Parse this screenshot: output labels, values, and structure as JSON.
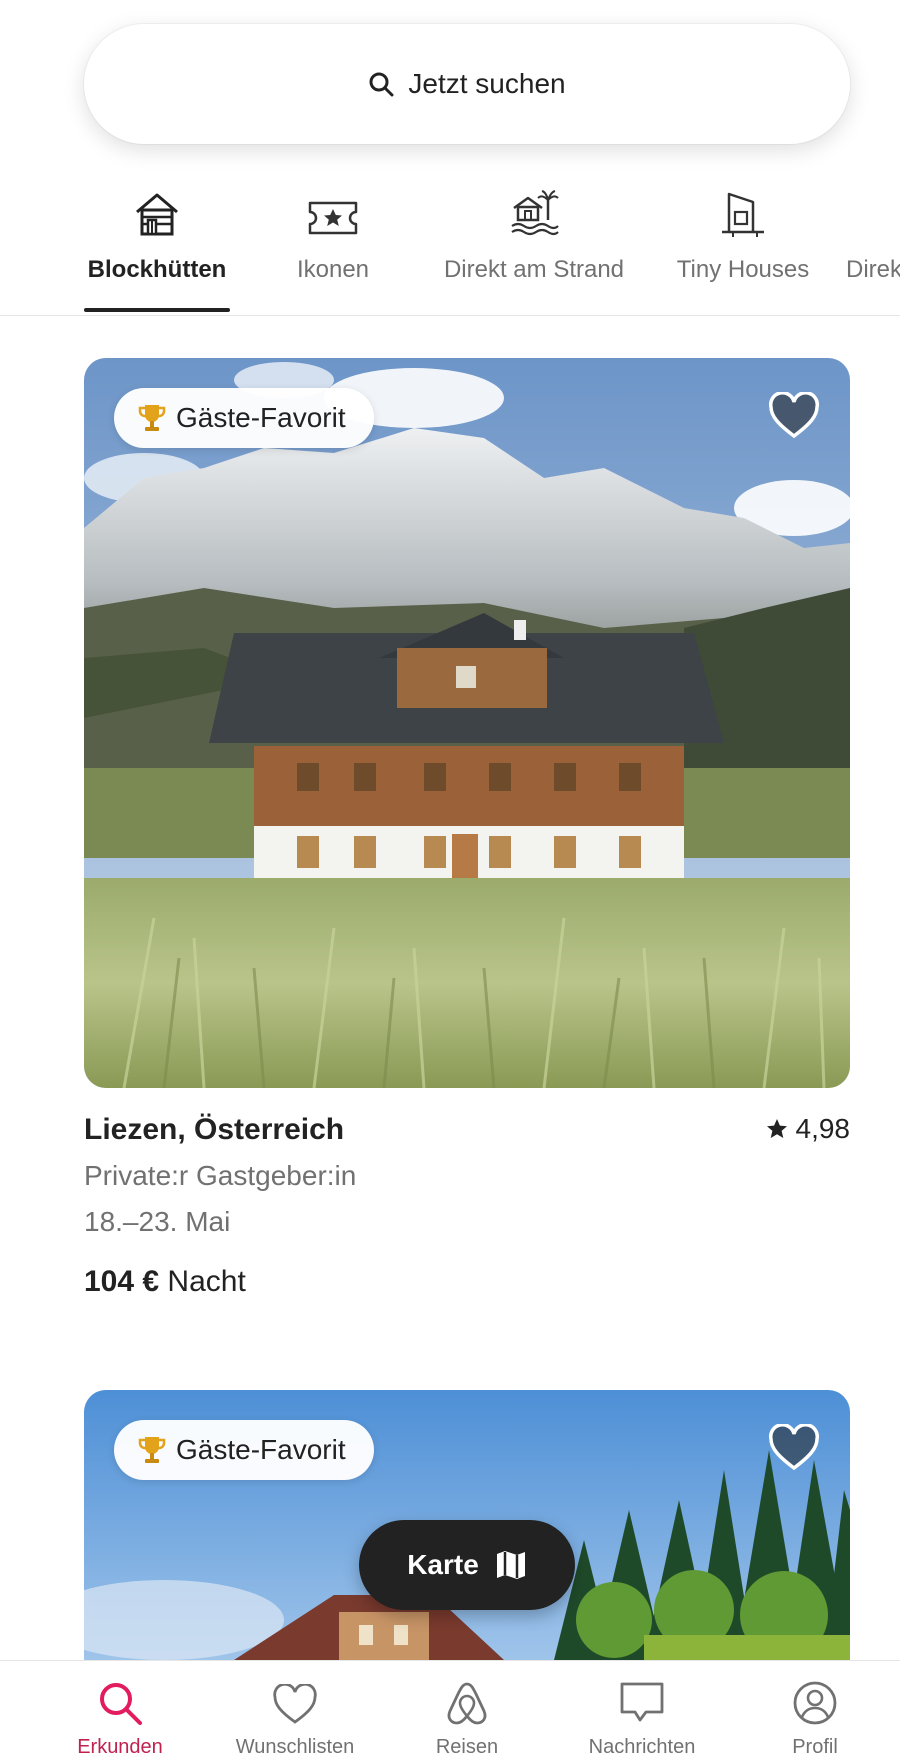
{
  "search": {
    "label": "Jetzt suchen",
    "icon": "search-icon"
  },
  "categories": [
    {
      "label": "Blockhütten",
      "icon": "cabin-icon",
      "active": true
    },
    {
      "label": "Ikonen",
      "icon": "ticket-star-icon",
      "active": false
    },
    {
      "label": "Direkt am Strand",
      "icon": "beach-house-icon",
      "active": false
    },
    {
      "label": "Tiny Houses",
      "icon": "tiny-house-icon",
      "active": false
    },
    {
      "label": "Direk",
      "icon": "",
      "active": false
    }
  ],
  "listings": [
    {
      "badge": "Gäste-Favorit",
      "location": "Liezen, Österreich",
      "rating": "4,98",
      "host": "Private:r Gastgeber:in",
      "dates": "18.–23. Mai",
      "price": "104 €",
      "price_unit": "Nacht"
    },
    {
      "badge": "Gäste-Favorit"
    }
  ],
  "map_button": {
    "label": "Karte",
    "icon": "map-icon"
  },
  "nav": [
    {
      "label": "Erkunden",
      "icon": "search-icon",
      "active": true
    },
    {
      "label": "Wunschlisten",
      "icon": "heart-icon",
      "active": false
    },
    {
      "label": "Reisen",
      "icon": "airbnb-logo-icon",
      "active": false
    },
    {
      "label": "Nachrichten",
      "icon": "message-icon",
      "active": false
    },
    {
      "label": "Profil",
      "icon": "profile-icon",
      "active": false
    }
  ],
  "colors": {
    "accent": "#E31C5F",
    "text": "#222222",
    "muted": "#717171"
  }
}
